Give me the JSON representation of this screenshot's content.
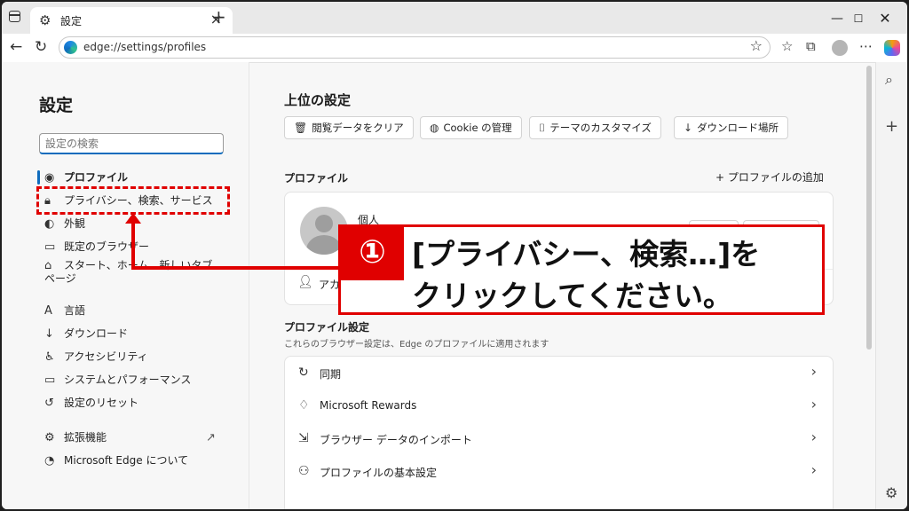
{
  "browser": {
    "tab_title": "設定",
    "url": "edge://settings/profiles"
  },
  "sidebar": {
    "title": "設定",
    "search_placeholder": "設定の検索",
    "items": [
      {
        "label": "プロファイル",
        "icon": "profile-icon",
        "active": true
      },
      {
        "label": "プライバシー、検索、サービス",
        "icon": "lock-icon"
      },
      {
        "label": "外観",
        "icon": "appearance-icon"
      },
      {
        "label": "既定のブラウザー",
        "icon": "browser-icon"
      },
      {
        "label": "スタート、ホーム、新しいタブ ページ",
        "icon": "home-icon"
      },
      {
        "label": "言語",
        "icon": "language-icon"
      },
      {
        "label": "ダウンロード",
        "icon": "download-icon"
      },
      {
        "label": "アクセシビリティ",
        "icon": "accessibility-icon"
      },
      {
        "label": "システムとパフォーマンス",
        "icon": "system-icon"
      },
      {
        "label": "設定のリセット",
        "icon": "reset-icon"
      },
      {
        "label": "拡張機能",
        "icon": "extension-icon"
      },
      {
        "label": "Microsoft Edge について",
        "icon": "edge-icon"
      }
    ]
  },
  "main": {
    "top_heading": "上位の設定",
    "quick_buttons": [
      {
        "label": "閲覧データをクリア",
        "icon": "trash-icon"
      },
      {
        "label": "Cookie の管理",
        "icon": "cookie-icon"
      },
      {
        "label": "テーマのカスタマイズ",
        "icon": "brush-icon"
      },
      {
        "label": "ダウンロード場所",
        "icon": "download-icon"
      }
    ],
    "profile_heading": "プロファイル",
    "add_profile": "プロファイルの追加",
    "profile_name": "個人",
    "account_text": "アカ",
    "profile_settings_heading": "プロファイル設定",
    "profile_settings_sub": "これらのブラウザー設定は、Edge のプロファイルに適用されます",
    "rows": [
      {
        "label": "同期",
        "icon": "sync-icon"
      },
      {
        "label": "Microsoft Rewards",
        "icon": "rewards-icon"
      },
      {
        "label": "ブラウザー データのインポート",
        "icon": "import-icon"
      },
      {
        "label": "プロファイルの基本設定",
        "icon": "profile-prefs-icon"
      }
    ]
  },
  "annotation": {
    "badge": "①",
    "line1": "[プライバシー、検索…]を",
    "line2": "クリックしてください。",
    "color": "#e00000"
  }
}
